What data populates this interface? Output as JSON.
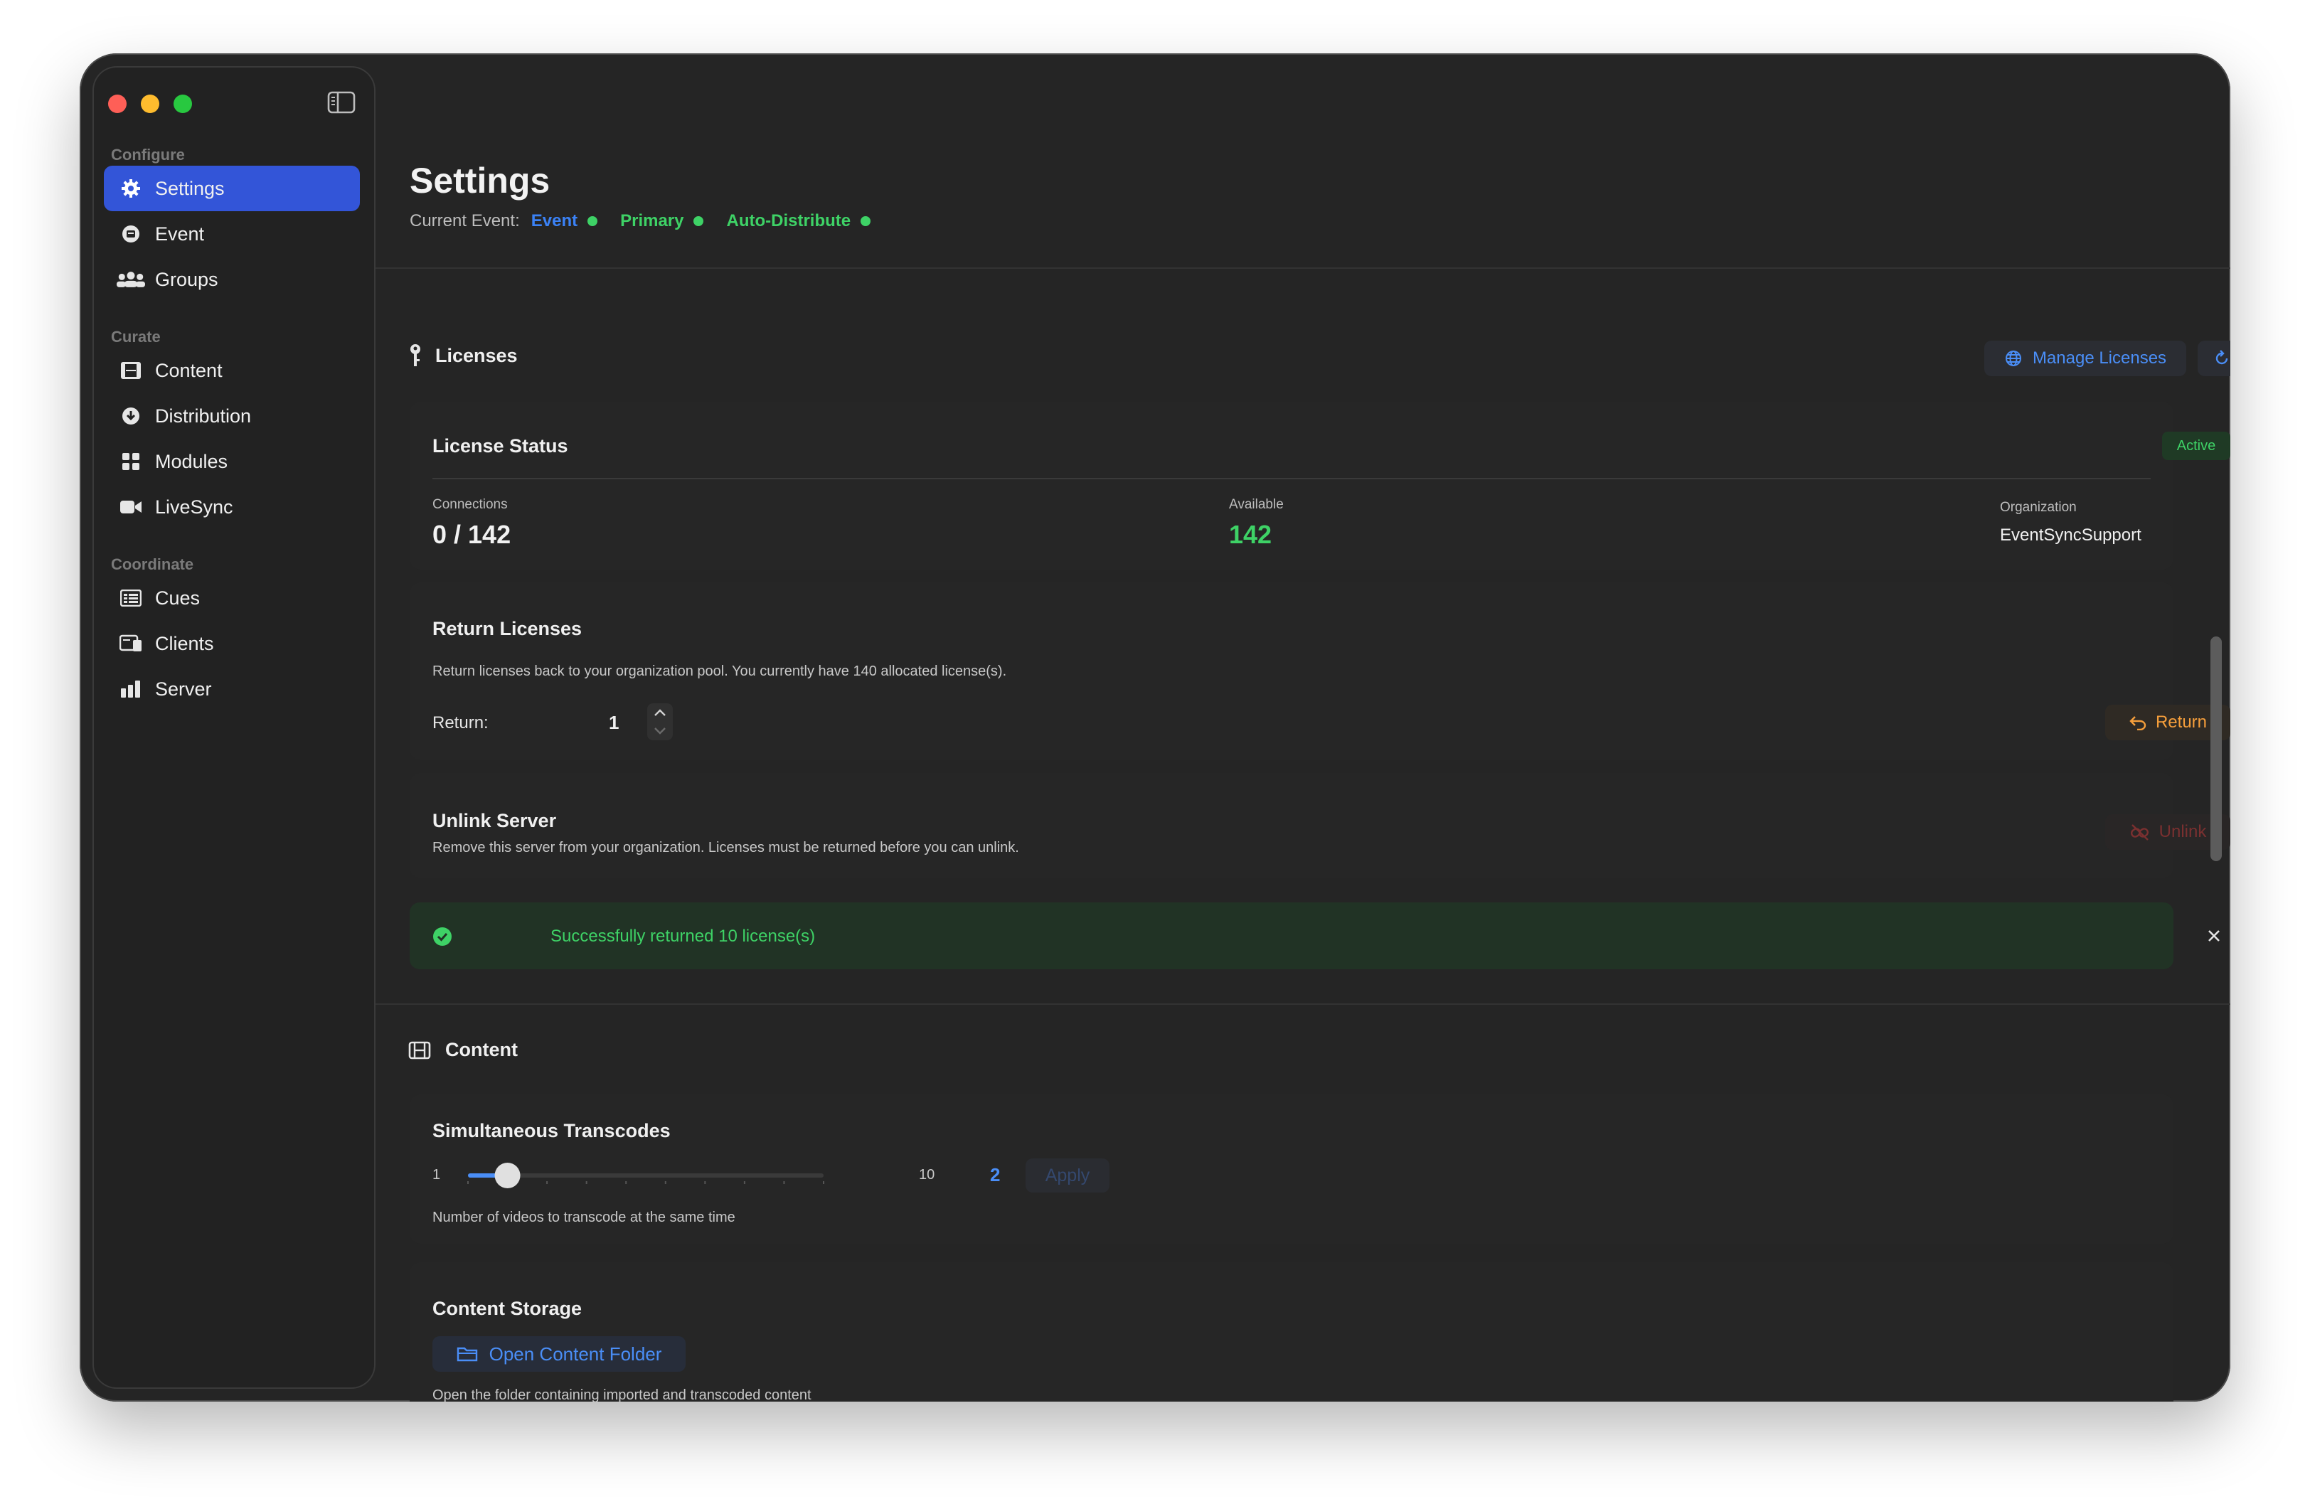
{
  "sidebar": {
    "sections": [
      {
        "label": "Configure",
        "items": [
          {
            "label": "Settings",
            "icon": "gear-icon",
            "active": true
          },
          {
            "label": "Event",
            "icon": "event-icon"
          },
          {
            "label": "Groups",
            "icon": "people-icon"
          }
        ]
      },
      {
        "label": "Curate",
        "items": [
          {
            "label": "Content",
            "icon": "film-icon"
          },
          {
            "label": "Distribution",
            "icon": "download-circle-icon"
          },
          {
            "label": "Modules",
            "icon": "grid-icon"
          },
          {
            "label": "LiveSync",
            "icon": "video-camera-icon"
          }
        ]
      },
      {
        "label": "Coordinate",
        "items": [
          {
            "label": "Cues",
            "icon": "list-icon"
          },
          {
            "label": "Clients",
            "icon": "clients-icon"
          },
          {
            "label": "Server",
            "icon": "bar-chart-icon"
          }
        ]
      }
    ]
  },
  "header": {
    "title": "Settings",
    "current_event_label": "Current Event:",
    "event_name": "Event",
    "role": "Primary",
    "mode": "Auto-Distribute"
  },
  "licenses": {
    "title": "Licenses",
    "manage_label": "Manage Licenses",
    "status": {
      "title": "License Status",
      "badge": "Active",
      "connections_label": "Connections",
      "connections_value": "0 / 142",
      "available_label": "Available",
      "available_value": "142",
      "organization_label": "Organization",
      "organization_value": "EventSyncSupport"
    },
    "return": {
      "title": "Return Licenses",
      "description": "Return licenses back to your organization pool. You currently have 140 allocated license(s).",
      "field_label": "Return:",
      "field_value": "1",
      "button_label": "Return"
    },
    "unlink": {
      "title": "Unlink Server",
      "description": "Remove this server from your organization. Licenses must be returned before you can unlink.",
      "button_label": "Unlink"
    },
    "success_message": "Successfully returned 10 license(s)"
  },
  "content": {
    "title": "Content",
    "transcodes": {
      "title": "Simultaneous Transcodes",
      "min_label": "1",
      "max_label": "10",
      "min": 1,
      "max": 10,
      "value": 2,
      "value_label": "2",
      "apply_label": "Apply",
      "description": "Number of videos to transcode at the same time"
    },
    "storage": {
      "title": "Content Storage",
      "button_label": "Open Content Folder",
      "description": "Open the folder containing imported and transcoded content"
    }
  },
  "colors": {
    "accent_blue": "#3b82f6",
    "active_nav": "#3355d8",
    "status_green": "#3ed266",
    "return_orange": "#f59e3b",
    "unlink_red": "#7a3030",
    "success_bg": "#213325"
  }
}
